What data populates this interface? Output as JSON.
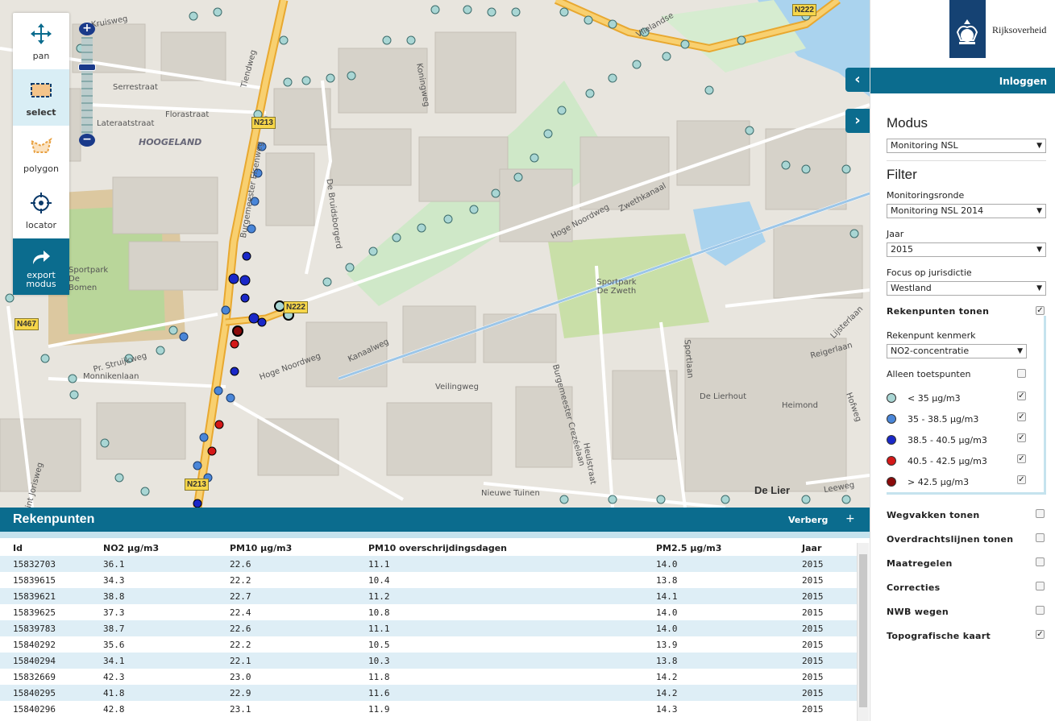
{
  "map": {
    "labels": [
      "Kruisweg",
      "Serrestraat",
      "Florastraat",
      "Lateraatstraat",
      "Tiendweg",
      "Koningweg",
      "Burgemeester Elsenweg",
      "De Bruidsborgerd",
      "Hoge Noordweg",
      "Zwethkanaal",
      "Kanaalweg",
      "Veilingweg",
      "Hoge Noordweg",
      "Monnikenlaan",
      "Pr. Struijkweg",
      "Sportpark De Bomen",
      "Sportpark De Zweth",
      "Burgemeester Crezéelaan",
      "Nieuwe Tuinen",
      "Heulstraat",
      "De Lierhout",
      "Sportlaan",
      "Hofweg",
      "Heimond",
      "Reigerlaan",
      "Lijsterlaan",
      "Vlielandse",
      "Leeweg",
      "Sint Jorisweg"
    ],
    "places": {
      "hoogeland": "HOOGELAND",
      "delier": "De Lier"
    },
    "signs": [
      "N222",
      "N213",
      "N222",
      "N467",
      "N213"
    ],
    "legend_colors": {
      "light": "#a9d6d4",
      "mid": "#4a86d8",
      "dark": "#1a28c8",
      "red": "#d41818",
      "darkred": "#8a0a0a"
    }
  },
  "toolbar": {
    "pan": "pan",
    "select": "select",
    "polygon": "polygon",
    "locator": "locator",
    "export": "export modus"
  },
  "panel": {
    "brand": "Rijksoverheid",
    "login": "Inloggen",
    "modus_title": "Modus",
    "modus_value": "Monitoring NSL",
    "filter_title": "Filter",
    "ronde_label": "Monitoringsronde",
    "ronde_value": "Monitoring NSL 2014",
    "jaar_label": "Jaar",
    "jaar_value": "2015",
    "focus_label": "Focus op jurisdictie",
    "focus_value": "Westland",
    "rekenpunten_label": "Rekenpunten tonen",
    "kenmerk_label": "Rekenpunt kenmerk",
    "kenmerk_value": "NO2-concentratie",
    "toets_label": "Alleen toetspunten",
    "legend": [
      {
        "label": "< 35 μg/m3",
        "color": "#a9d6d4"
      },
      {
        "label": "35 - 38.5 μg/m3",
        "color": "#4a86d8"
      },
      {
        "label": "38.5 - 40.5 μg/m3",
        "color": "#1a28c8"
      },
      {
        "label": "40.5 - 42.5 μg/m3",
        "color": "#d41818"
      },
      {
        "label": "> 42.5 μg/m3",
        "color": "#8a0a0a"
      }
    ],
    "layers": [
      "Wegvakken tonen",
      "Overdrachtslijnen tonen",
      "Maatregelen",
      "Correcties",
      "NWB wegen",
      "Topografische kaart"
    ]
  },
  "table": {
    "title": "Rekenpunten",
    "hide": "Verberg",
    "plus": "+",
    "headers": [
      "Id",
      "NO2 μg/m3",
      "PM10 μg/m3",
      "PM10 overschrijdingsdagen",
      "PM2.5 μg/m3",
      "Jaar"
    ],
    "rows": [
      [
        "15832703",
        "36.1",
        "22.6",
        "11.1",
        "14.0",
        "2015"
      ],
      [
        "15839615",
        "34.3",
        "22.2",
        "10.4",
        "13.8",
        "2015"
      ],
      [
        "15839621",
        "38.8",
        "22.7",
        "11.2",
        "14.1",
        "2015"
      ],
      [
        "15839625",
        "37.3",
        "22.4",
        "10.8",
        "14.0",
        "2015"
      ],
      [
        "15839783",
        "38.7",
        "22.6",
        "11.1",
        "14.0",
        "2015"
      ],
      [
        "15840292",
        "35.6",
        "22.2",
        "10.5",
        "13.9",
        "2015"
      ],
      [
        "15840294",
        "34.1",
        "22.1",
        "10.3",
        "13.8",
        "2015"
      ],
      [
        "15832669",
        "42.3",
        "23.0",
        "11.8",
        "14.2",
        "2015"
      ],
      [
        "15840295",
        "41.8",
        "22.9",
        "11.6",
        "14.2",
        "2015"
      ],
      [
        "15840296",
        "42.8",
        "23.1",
        "11.9",
        "14.3",
        "2015"
      ]
    ]
  }
}
